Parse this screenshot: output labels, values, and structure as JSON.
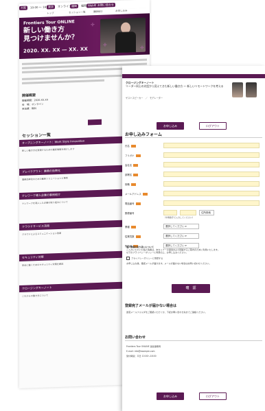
{
  "top_nav": {
    "items": [
      {
        "label": "大阪",
        "pill": true
      },
      {
        "label": "10:00 〜 18:00",
        "pill": false
      },
      {
        "label": "東京",
        "pill": true
      },
      {
        "label": "オンライン",
        "pill": false
      },
      {
        "label": "福岡",
        "pill": true
      },
      {
        "label": "福岡",
        "pill": false
      },
      {
        "label": "Web申し込み",
        "pill": true
      },
      {
        "label": "お問い合わせ",
        "pill": true
      }
    ],
    "sub_items": [
      "トップ",
      "セッション一覧",
      "講師紹介",
      "お申し込み"
    ]
  },
  "hero": {
    "brand": "Frontiers Tour ONLINE",
    "headline_1": "新しい働き方",
    "headline_2": "見つけませんか？",
    "date": "2020. XX. XX  ―  XX. XX"
  },
  "event_meta": {
    "title": "開催概要",
    "lines": [
      "開催期間：2020.XX.XX",
      "会　場：オンライン",
      "参加費：無料"
    ]
  },
  "sessions": {
    "title": "セッション一覧",
    "items": [
      {
        "title": "オープニングキーノート：Work Style Innovation",
        "desc": "新しい働き方を実現するための最新情報を紹介します"
      },
      {
        "title": "ブレイクアウト：業務の効率化",
        "desc": "業務効率化のための最新ソリューションと事例"
      },
      {
        "title": "テレワーク導入企業の事例紹介",
        "desc": "テレワークを導入した企業の取り組みについて"
      },
      {
        "title": "クラウドサービス活用",
        "desc": "クラウドによるコミュニケーション改革"
      },
      {
        "title": "セキュリティ対策",
        "desc": "安全に働くためのセキュリティ対策を解説"
      },
      {
        "title": "クロージングキーノート",
        "desc": "これからの働き方について"
      }
    ]
  },
  "form_page": {
    "banner_title_1": "クロージングキーノート",
    "banner_title_2": "リーダー同士の対話から見えてきた新しい働き方 〜 新しいリモートワークを考える",
    "banner_names": "ゲストスピーカー　／　モデレーター",
    "buttons": {
      "apply": "お申し込み",
      "logout": "ログアウト"
    },
    "form_title": "お申し込みフォーム",
    "required": "必須",
    "fields": [
      {
        "label": "氏名"
      },
      {
        "label": "フリガナ"
      },
      {
        "label": "会社名"
      },
      {
        "label": "部署名"
      },
      {
        "label": "役職"
      },
      {
        "label": "メールアドレス"
      },
      {
        "label": "電話番号"
      }
    ],
    "select_labels": [
      "業種",
      "従業員数",
      "所在地"
    ],
    "select_value": "選択してください",
    "zip_label": "郵便番号",
    "zip_button": "住所検索",
    "hint": "（半角数字で入力してください）",
    "notes": [
      "個人情報の取り扱いについて",
      "ご入力いただいた個人情報は、本セミナーの運営および関連するご案内のために利用いたします。",
      "以下のプライバシーポリシーに同意の上、お申し込みください。",
      "お申し込み後、確認メールが届きます。メールが届かない場合はお問い合わせください。"
    ],
    "agree": "プライバシーポリシーに同意する",
    "submit": "確　認",
    "mail_title": "登録完了メールが届かない場合は",
    "mail_text": "迷惑メールフォルダをご確認いただくか、下記お問い合わせ先までご連絡ください。",
    "contact_title": "お問い合わせ",
    "contact_lines": [
      "Frontiers Tour ONLINE 運営事務局",
      "E-mail: info@example.com",
      "受付時間：平日 10:00〜18:00"
    ]
  }
}
